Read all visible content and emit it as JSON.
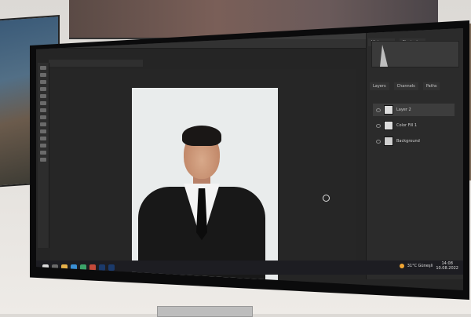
{
  "scene": {
    "description_type": "photo-of-monitor"
  },
  "photoshop": {
    "layers_panel": {
      "tabs": [
        "Layers",
        "Channels",
        "Paths"
      ],
      "layers": [
        {
          "name": "Layer 2"
        },
        {
          "name": "Color Fill 1"
        },
        {
          "name": "Background"
        }
      ]
    },
    "top_panel_tabs": [
      "Histogram",
      "Navigator"
    ]
  },
  "taskbar": {
    "weather": "31°C  Güneşli",
    "time": "14:08",
    "date": "10.08.2022"
  },
  "colors": {
    "accent_sun": "#f1a633",
    "photoshop_bg": "#252525"
  }
}
